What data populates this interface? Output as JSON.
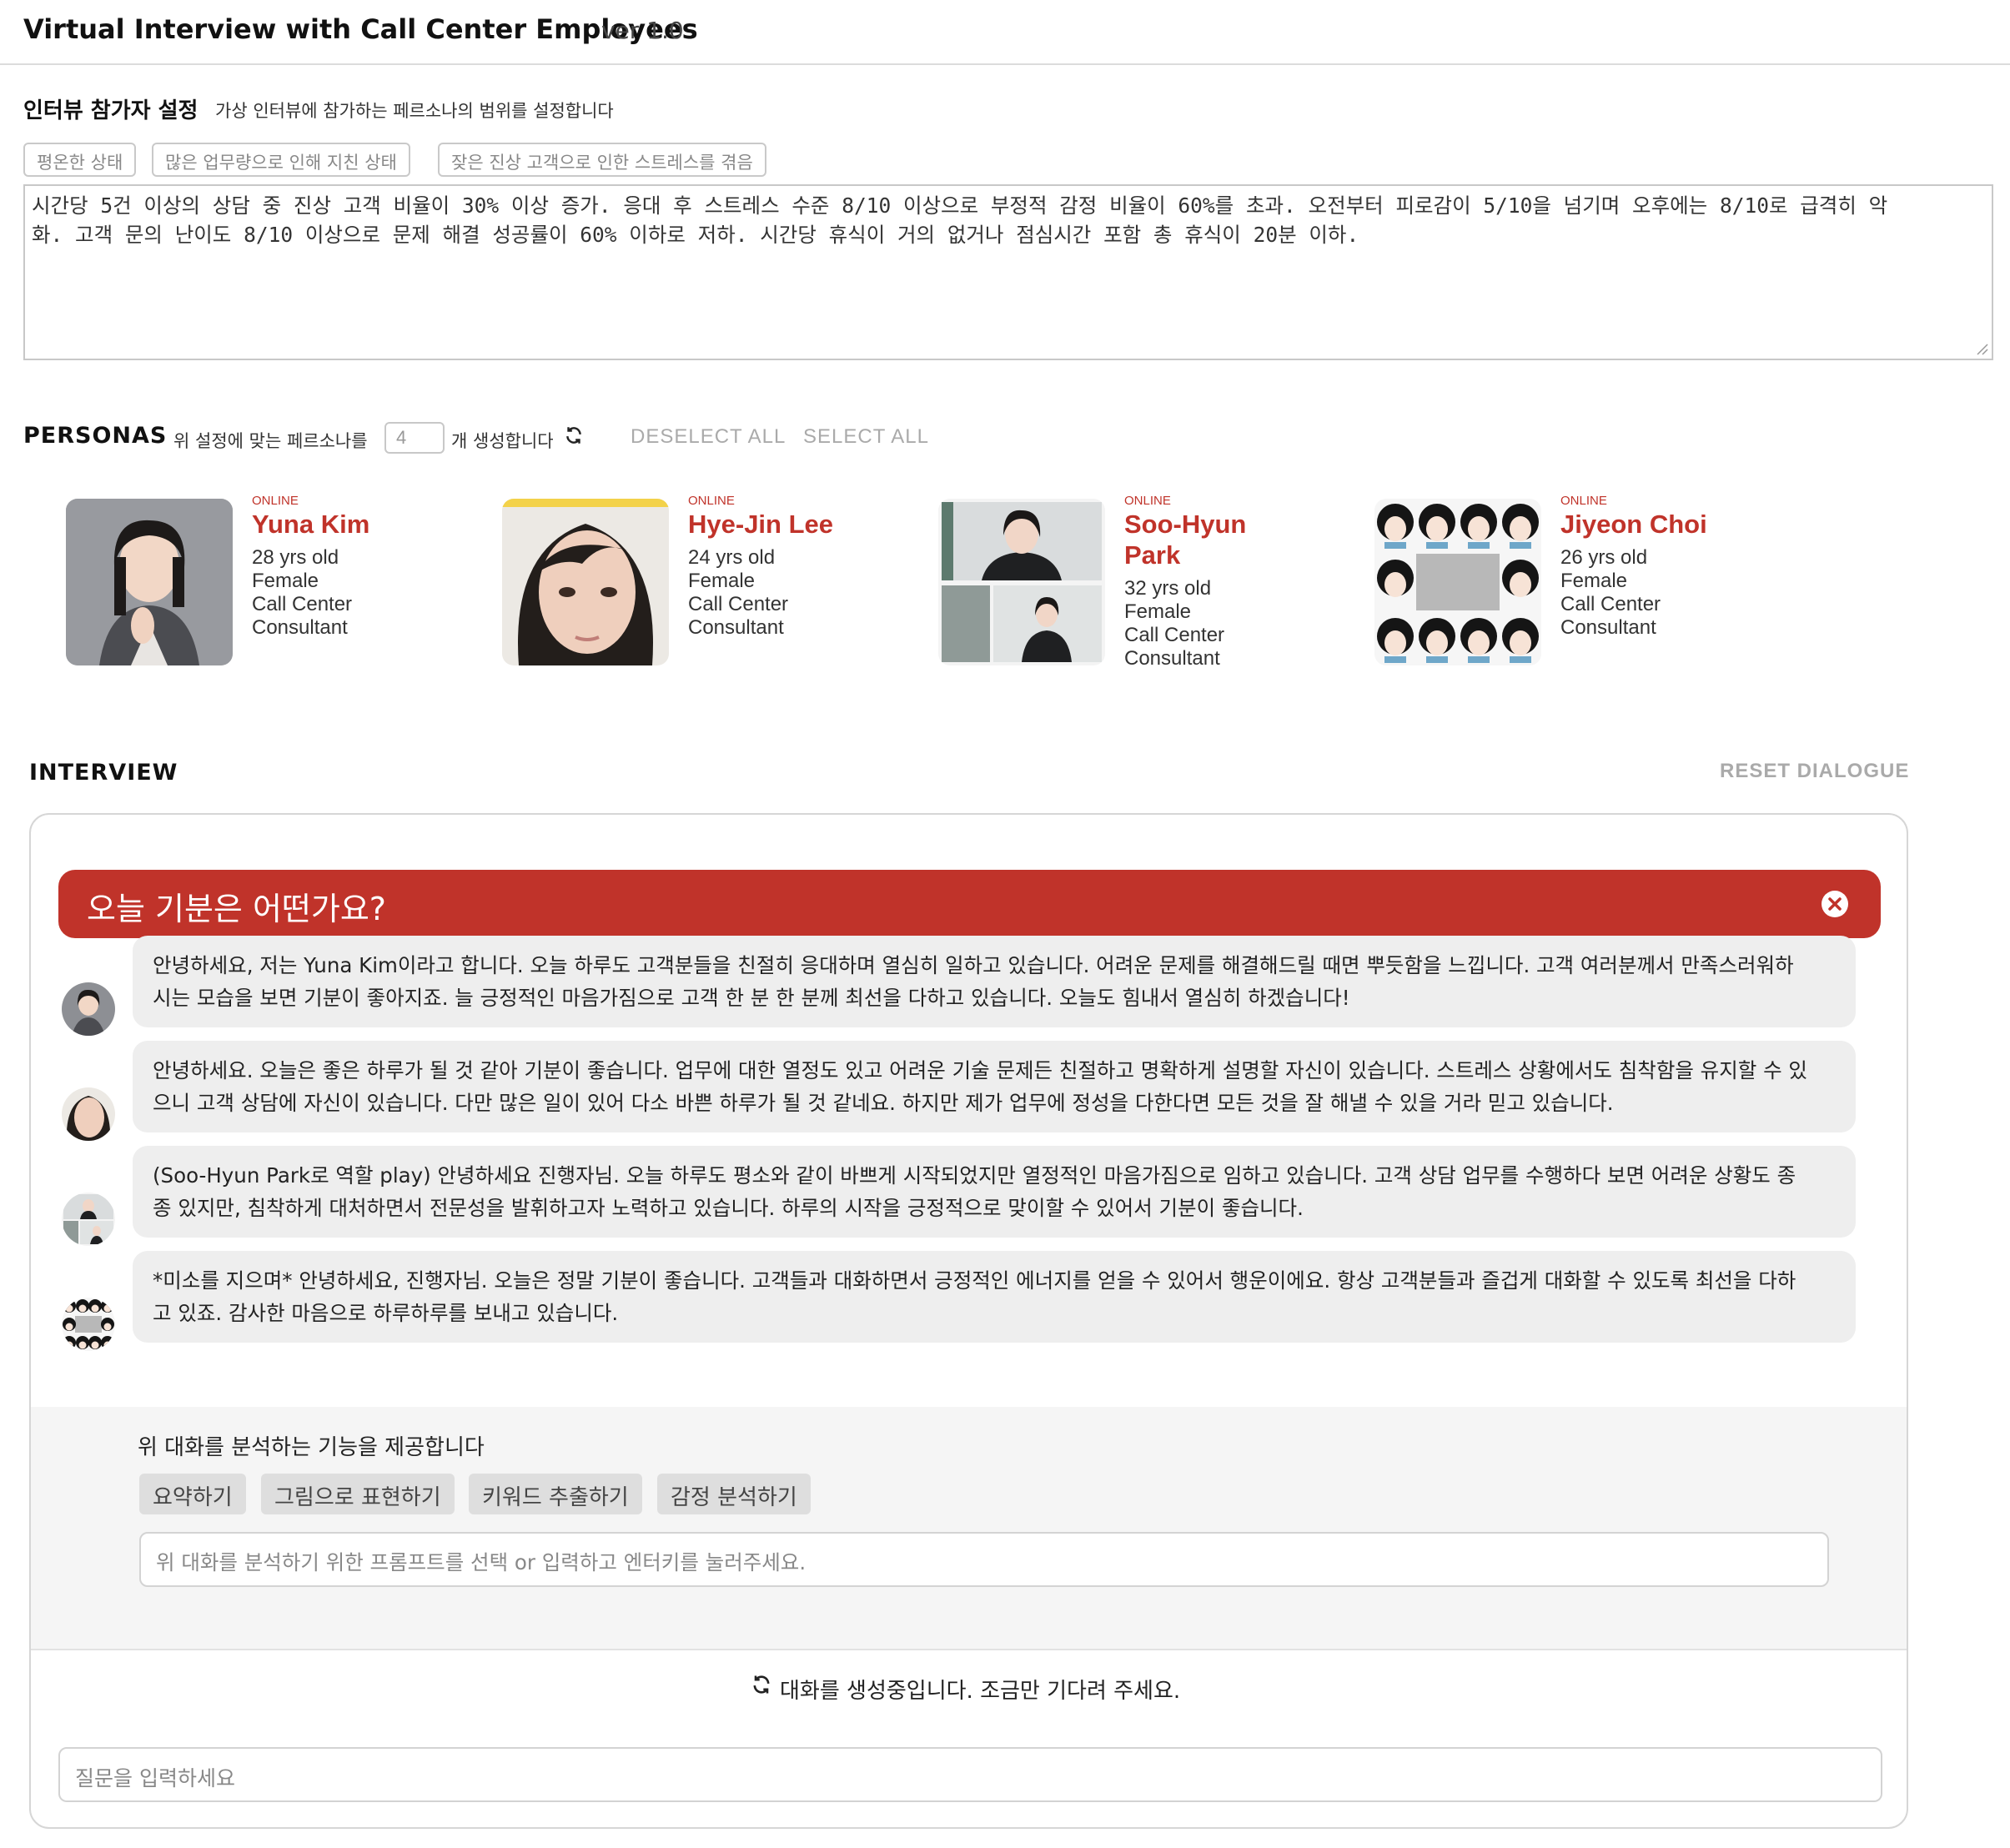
{
  "header": {
    "title": "Virtual Interview with Call Center Employees",
    "version": "ver 1.0"
  },
  "settings": {
    "title": "인터뷰 참가자 설정",
    "description": "가상 인터뷰에 참가하는 페르소나의 범위를 설정합니다",
    "presets": [
      "평온한 상태",
      "많은 업무량으로 인해 지친 상태",
      "잦은 진상 고객으로 인한 스트레스를 겪음"
    ],
    "condition_line1": "시간당 5건 이상의 상담 중 진상 고객 비율이 30% 이상 증가. 응대 후 스트레스 수준 8/10 이상으로 부정적 감정 비율이 60%를 초과. 오전부터 피로감이 5/10을 넘기며 오후에는 8/10로 급격히 악",
    "condition_line2": "화. 고객 문의 난이도 8/10 이상으로 문제 해결 성공률이 60% 이하로 저하. 시간당 휴식이 거의 없거나 점심시간 포함 총 휴식이 20분 이하."
  },
  "personas": {
    "title": "PERSONAS",
    "pre_text": "위 설정에 맞는 페르소나를",
    "count": "4",
    "post_text": "개 생성합니다",
    "refresh_icon": "refresh-icon",
    "deselect_all": "DESELECT ALL",
    "select_all": "SELECT ALL",
    "items": [
      {
        "status": "ONLINE",
        "name": "Yuna Kim",
        "age": "28 yrs old",
        "gender": "Female",
        "role1": "Call Center",
        "role2": "Consultant"
      },
      {
        "status": "ONLINE",
        "name": "Hye-Jin Lee",
        "age": "24 yrs old",
        "gender": "Female",
        "role1": "Call Center",
        "role2": "Consultant"
      },
      {
        "status": "ONLINE",
        "name1": "Soo-Hyun",
        "name2": "Park",
        "age": "32 yrs old",
        "gender": "Female",
        "role1": "Call Center",
        "role2": "Consultant"
      },
      {
        "status": "ONLINE",
        "name": "Jiyeon Choi",
        "age": "26 yrs old",
        "gender": "Female",
        "role1": "Call Center",
        "role2": "Consultant"
      }
    ]
  },
  "interview": {
    "title": "INTERVIEW",
    "reset": "RESET DIALOGUE",
    "question": "오늘 기분은 어떤가요?",
    "messages": [
      {
        "line1": "안녕하세요, 저는 Yuna Kim이라고 합니다. 오늘 하루도 고객분들을 친절히 응대하며 열심히 일하고 있습니다. 어려운 문제를 해결해드릴 때면 뿌듯함을 느낍니다. 고객 여러분께서 만족스러워하",
        "line2": "시는 모습을 보면 기분이 좋아지죠. 늘 긍정적인 마음가짐으로 고객 한 분 한 분께 최선을 다하고 있습니다. 오늘도 힘내서 열심히 하겠습니다!"
      },
      {
        "line1": "안녕하세요. 오늘은 좋은 하루가 될 것 같아 기분이 좋습니다. 업무에 대한 열정도 있고 어려운 기술 문제든 친절하고 명확하게 설명할 자신이 있습니다. 스트레스 상황에서도 침착함을 유지할 수 있",
        "line2": "으니 고객 상담에 자신이 있습니다. 다만 많은 일이 있어 다소 바쁜 하루가 될 것 같네요. 하지만 제가 업무에 정성을 다한다면 모든 것을 잘 해낼 수 있을 거라 믿고 있습니다."
      },
      {
        "line1": "(Soo-Hyun Park로 역할 play) 안녕하세요 진행자님. 오늘 하루도 평소와 같이 바쁘게 시작되었지만 열정적인 마음가짐으로 임하고 있습니다. 고객 상담 업무를 수행하다 보면 어려운 상황도 종",
        "line2": "종 있지만, 침착하게 대처하면서 전문성을 발휘하고자 노력하고 있습니다. 하루의 시작을 긍정적으로 맞이할 수 있어서 기분이 좋습니다."
      },
      {
        "line1": "*미소를 지으며* 안녕하세요, 진행자님. 오늘은 정말 기분이 좋습니다. 고객들과 대화하면서 긍정적인 에너지를 얻을 수 있어서 행운이에요. 항상 고객분들과 즐겁게 대화할 수 있도록 최선을 다하",
        "line2": "고 있죠. 감사한 마음으로 하루하루를 보내고 있습니다."
      }
    ],
    "analysis": {
      "title": "위 대화를 분석하는 기능을 제공합니다",
      "options": [
        "요약하기",
        "그림으로 표현하기",
        "키워드 추출하기",
        "감정 분석하기"
      ],
      "placeholder": "위 대화를 분석하기 위한 프롬프트를 선택 or 입력하고 엔터키를 눌러주세요."
    },
    "loading": "대화를 생성중입니다. 조금만 기다려 주세요.",
    "question_placeholder": "질문을 입력하세요"
  },
  "colors": {
    "accent": "#c0332a",
    "bubble": "#eeeeee",
    "muted": "#aaaaaa"
  }
}
